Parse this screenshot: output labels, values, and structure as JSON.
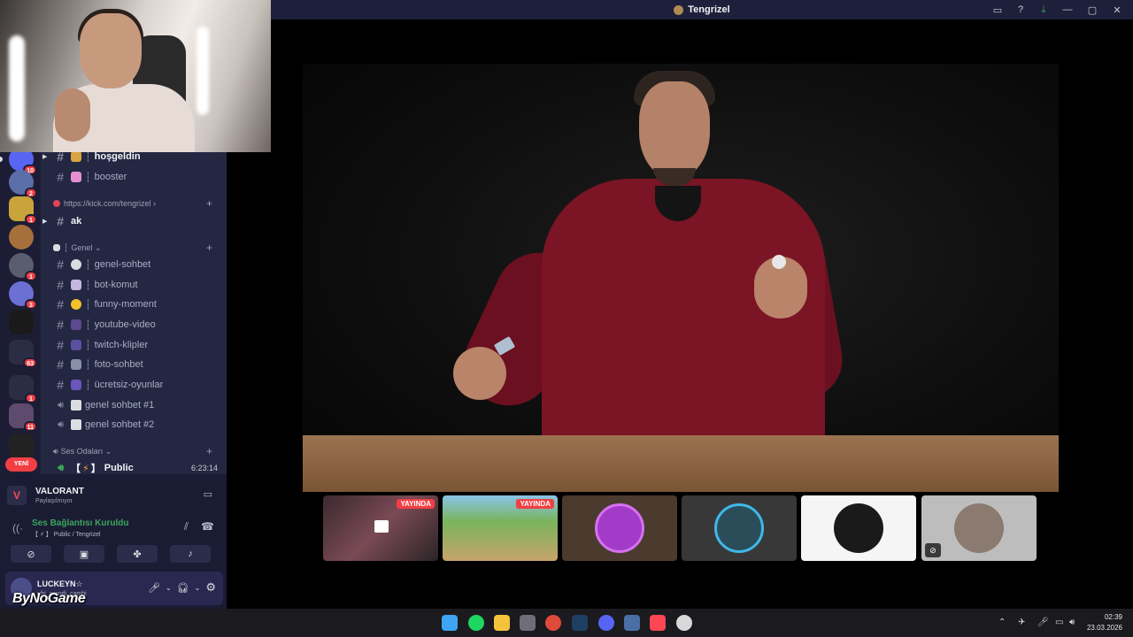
{
  "window": {
    "title": "Tengrizel",
    "controls": [
      "cast-icon",
      "help-icon",
      "download-icon",
      "minimize-icon",
      "maximize-icon",
      "close-icon"
    ]
  },
  "server_rail": {
    "badges": [
      "10",
      "2",
      "1",
      "",
      "1",
      "3",
      "",
      "63",
      "1",
      "11",
      ""
    ],
    "new_label": "YENİ"
  },
  "channels": {
    "top": [
      {
        "name": "hoşgeldin",
        "sep": "┆",
        "bold": true
      },
      {
        "name": "booster",
        "sep": "┆",
        "bold": false
      }
    ],
    "kick_category": "https://kick.com/tengrizel",
    "kick_channel": "ak",
    "genel_category": "Genel",
    "genel": [
      {
        "name": "genel-sohbet",
        "sep": "┆"
      },
      {
        "name": "bot-komut",
        "sep": "┆"
      },
      {
        "name": "funny-moment",
        "sep": "┆"
      },
      {
        "name": "youtube-video",
        "sep": "┆"
      },
      {
        "name": "twitch-klipler",
        "sep": "┆"
      },
      {
        "name": "foto-sohbet",
        "sep": "┆"
      },
      {
        "name": "ücretsiz-oyunlar",
        "sep": "┆"
      }
    ],
    "voice": [
      "genel sohbet #1",
      "genel sohbet #2"
    ],
    "ses_category": "Ses Odaları",
    "public_prefix": "【",
    "public_suffix": "】",
    "public_name": "Public",
    "public_time": "6:23:14"
  },
  "activity": {
    "game": "VALORANT",
    "status": "Paylaşılmıyor"
  },
  "voice_status": {
    "title": "Ses Bağlantısı Kuruldu",
    "subtitle": "【 ⚡ 】 Public / Tengrizel"
  },
  "user": {
    "name": "LUCKEYN☆",
    "status": "ufri_arendi, cambi"
  },
  "watermark": "ByNoGame",
  "thumbnails": [
    {
      "live": "YAYINDA"
    },
    {
      "live": "YAYINDA"
    },
    {
      "live": ""
    },
    {
      "live": ""
    },
    {
      "live": ""
    },
    {
      "live": ""
    }
  ],
  "clock": {
    "time": "02:39",
    "date": "23.03.2026"
  }
}
